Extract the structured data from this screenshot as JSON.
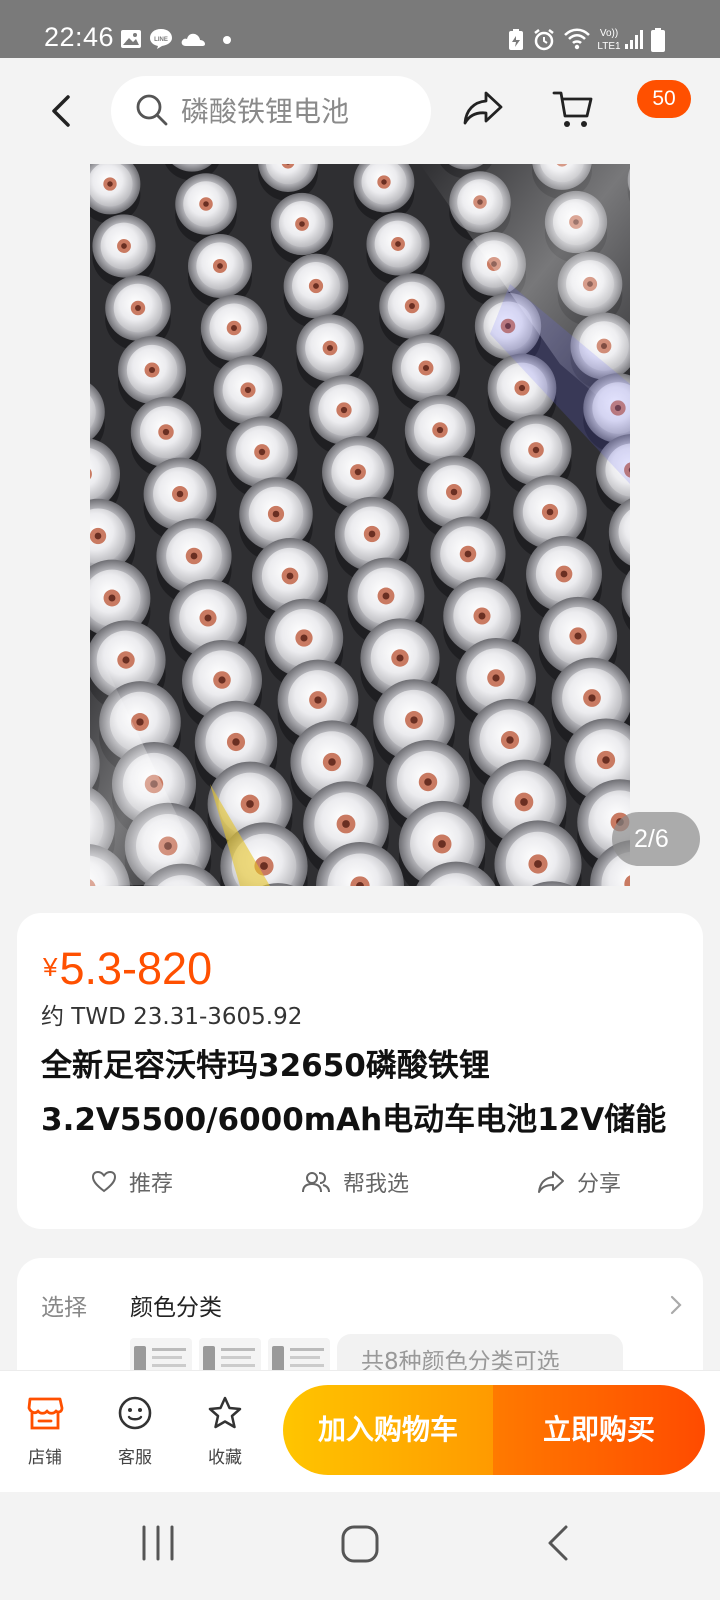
{
  "status_bar": {
    "time": "22:46",
    "left_icons": [
      "gallery-icon",
      "line-icon",
      "cloud-icon",
      "dot-icon"
    ],
    "right_icons": [
      "battery-saver-icon",
      "alarm-icon",
      "wifi-icon",
      "volte-icon",
      "signal-icon",
      "battery-icon"
    ],
    "volte_text": "Vo))\nLTE1"
  },
  "header": {
    "search_placeholder": "磷酸铁锂电池",
    "badge_count": "50"
  },
  "gallery": {
    "page_indicator": "2/6",
    "current_page": 2,
    "total_pages": 6
  },
  "product": {
    "currency_symbol": "¥",
    "price_range": "5.3-820",
    "approx_price": "约 TWD 23.31-3605.92",
    "title_line1": "全新足容沃特玛32650磷酸铁锂",
    "title_line2": "3.2V5500/6000mAh电动车电池12V储能",
    "actions": [
      {
        "label": "推荐",
        "icon": "heart-icon"
      },
      {
        "label": "帮我选",
        "icon": "group-icon"
      },
      {
        "label": "分享",
        "icon": "share-icon"
      }
    ]
  },
  "options": {
    "label": "选择",
    "title": "颜色分类",
    "more_text": "共8种颜色分类可选"
  },
  "bottom_bar": {
    "tabs": [
      {
        "label": "店铺",
        "icon": "shop-icon"
      },
      {
        "label": "客服",
        "icon": "customer-service-icon"
      },
      {
        "label": "收藏",
        "icon": "star-icon"
      }
    ],
    "add_to_cart": "加入购物车",
    "buy_now": "立即购买"
  },
  "colors": {
    "accent": "#ff5000",
    "cart_gradient_start": "#ffc500",
    "buy_gradient_end": "#ff4b00",
    "status_bar": "#7a7a7a"
  }
}
